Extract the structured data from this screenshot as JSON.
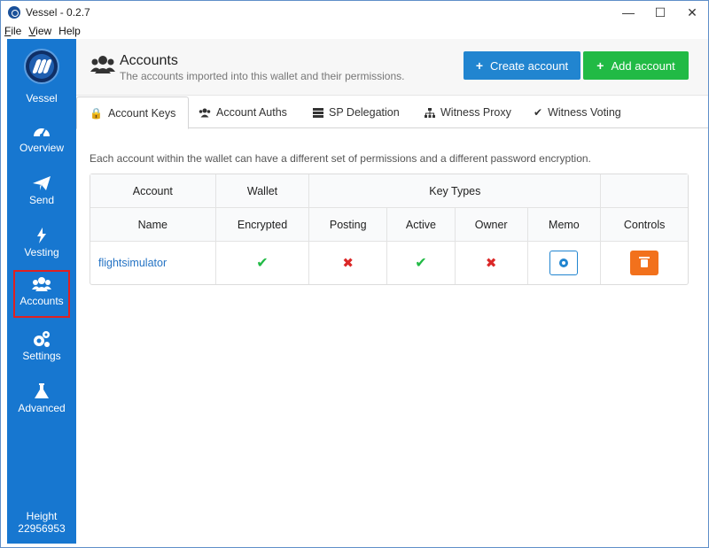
{
  "window": {
    "title": "Vessel - 0.2.7",
    "controls": {
      "minimize": "—",
      "maximize": "☐",
      "close": "✕"
    }
  },
  "menu": [
    {
      "underline": "F",
      "rest": "ile"
    },
    {
      "underline": "V",
      "rest": "iew"
    },
    {
      "underline": "",
      "rest": "Help"
    }
  ],
  "sidebar": {
    "brand": "Vessel",
    "items": [
      {
        "label": "Overview",
        "icon": "dashboard-icon"
      },
      {
        "label": "Send",
        "icon": "paper-plane-icon"
      },
      {
        "label": "Vesting",
        "icon": "lightning-icon"
      },
      {
        "label": "Accounts",
        "icon": "users-icon",
        "selected": true
      },
      {
        "label": "Settings",
        "icon": "cogs-icon"
      },
      {
        "label": "Advanced",
        "icon": "flask-icon"
      }
    ],
    "height_label": "Height",
    "height_value": "22956953"
  },
  "header": {
    "title": "Accounts",
    "subtitle": "The accounts imported into this wallet and their permissions.",
    "create_button": "Create account",
    "add_button": "Add account"
  },
  "tabs": [
    {
      "label": "Account Keys",
      "icon": "lock-icon",
      "active": true
    },
    {
      "label": "Account Auths",
      "icon": "users-icon"
    },
    {
      "label": "SP Delegation",
      "icon": "server-icon"
    },
    {
      "label": "Witness Proxy",
      "icon": "sitemap-icon"
    },
    {
      "label": "Witness Voting",
      "icon": "check-icon"
    }
  ],
  "description": "Each account within the wallet can have a different set of permissions and a different password encryption.",
  "table": {
    "group_headers": {
      "account": "Account",
      "wallet": "Wallet",
      "key_types": "Key Types"
    },
    "columns": [
      "Name",
      "Encrypted",
      "Posting",
      "Active",
      "Owner",
      "Memo",
      "Controls"
    ],
    "rows": [
      {
        "name": "flightsimulator",
        "encrypted": true,
        "posting": false,
        "active": true,
        "owner": false
      }
    ]
  },
  "colors": {
    "sidebar": "#1777d0",
    "create": "#2185d0",
    "add": "#21ba45",
    "delete": "#f2711c",
    "check": "#21ba45",
    "cross": "#db2828"
  }
}
